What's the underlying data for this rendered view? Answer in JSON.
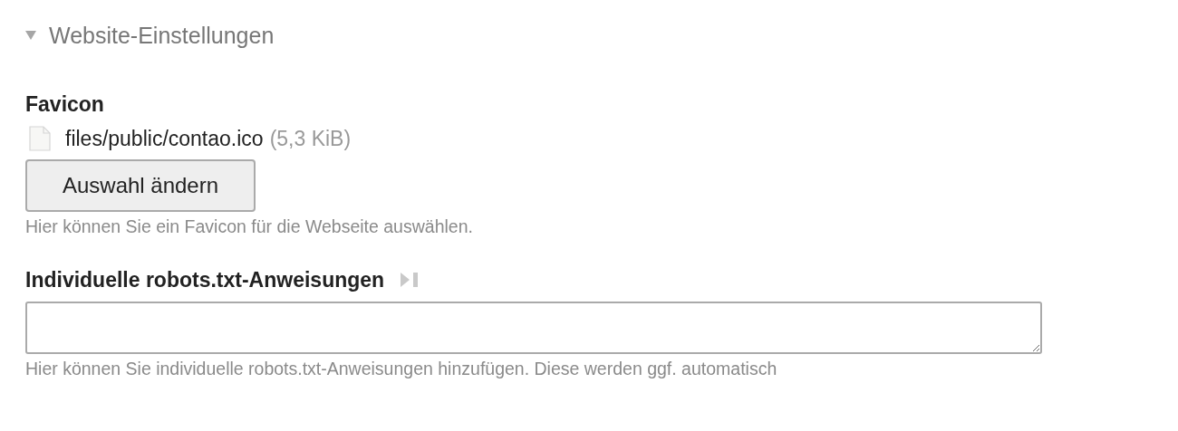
{
  "section": {
    "title": "Website-Einstellungen",
    "expanded": true
  },
  "favicon": {
    "label": "Favicon",
    "file": "files/public/contao.ico",
    "size": "(5,3 KiB)",
    "button": "Auswahl ändern",
    "help": "Hier können Sie ein Favicon für die Webseite auswählen."
  },
  "robots": {
    "label": "Individuelle robots.txt-Anweisungen",
    "help": "Hier können Sie individuelle robots.txt-Anweisungen hinzufügen. Diese werden ggf. automatisch"
  }
}
